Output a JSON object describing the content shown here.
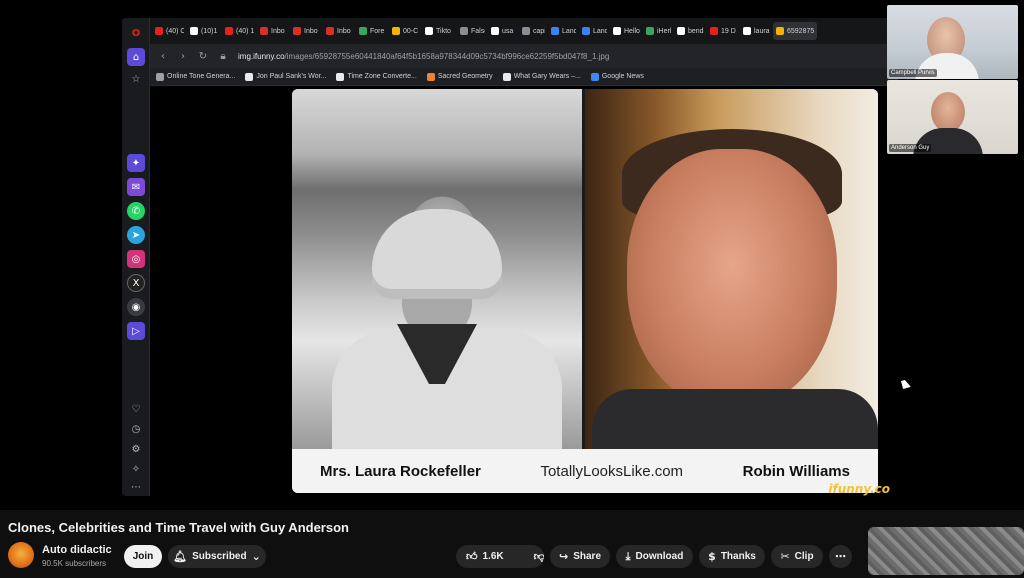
{
  "browser": {
    "tabs": [
      {
        "label": "(40) C",
        "color": "#e62117"
      },
      {
        "label": "(10)1",
        "color": "#ffffff"
      },
      {
        "label": "(40) 1",
        "color": "#e62117"
      },
      {
        "label": "Inbo",
        "color": "#d93025"
      },
      {
        "label": "Inbo",
        "color": "#d93025"
      },
      {
        "label": "Inbo",
        "color": "#d93025"
      },
      {
        "label": "Fore",
        "color": "#3ba55c"
      },
      {
        "label": "00-C",
        "color": "#f4b400"
      },
      {
        "label": "Tikto",
        "color": "#ffffff"
      },
      {
        "label": "Falsc",
        "color": "#8a8d93"
      },
      {
        "label": "usa",
        "color": "#ffffff"
      },
      {
        "label": "capit",
        "color": "#8a8d93"
      },
      {
        "label": "Land",
        "color": "#3b82f6"
      },
      {
        "label": "Land",
        "color": "#3b82f6"
      },
      {
        "label": "Hello",
        "color": "#ffffff"
      },
      {
        "label": "iHerb",
        "color": "#3ba55c"
      },
      {
        "label": "bend",
        "color": "#ffffff"
      },
      {
        "label": "19 D",
        "color": "#e62117"
      },
      {
        "label": "laura",
        "color": "#ffffff"
      },
      {
        "label": "6592875",
        "color": "#f4b400"
      }
    ],
    "url_host": "img.ifunny.co",
    "url_path": "/images/65928755e60441840af64f5b1658a978344d09c5734bf996ce62259f5bd047f8_1.jpg",
    "bookmarks": [
      {
        "label": "Online Tone Genera..."
      },
      {
        "label": "Jon Paul Sank's Wor..."
      },
      {
        "label": "Time Zone Converte..."
      },
      {
        "label": "Sacred Geometry"
      },
      {
        "label": "What Gary Wears –..."
      },
      {
        "label": "Google News"
      }
    ]
  },
  "meme": {
    "left_caption": "Mrs. Laura Rockefeller",
    "center_caption": "TotallyLooksLike.com",
    "right_caption": "Robin Williams",
    "watermark": "ifunny.co"
  },
  "cams": [
    {
      "name": "Campbell Purvis"
    },
    {
      "name": "Anderson Guy"
    }
  ],
  "video": {
    "title": "Clones, Celebrities and Time Travel with Guy Anderson",
    "channel": "Auto didactic",
    "subscribers": "90.5K subscribers",
    "join_label": "Join",
    "subscribed_label": "Subscribed",
    "likes": "1.6K",
    "share_label": "Share",
    "download_label": "Download",
    "thanks_label": "Thanks",
    "clip_label": "Clip"
  }
}
